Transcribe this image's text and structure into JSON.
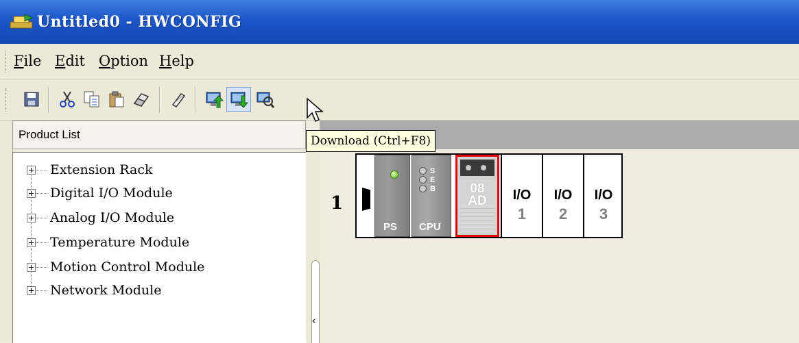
{
  "window": {
    "title": "Untitled0 - HWCONFIG"
  },
  "menu": [
    {
      "accel": "F",
      "rest": "ile"
    },
    {
      "accel": "E",
      "rest": "dit"
    },
    {
      "accel": "O",
      "rest": "ption"
    },
    {
      "accel": "H",
      "rest": "elp"
    }
  ],
  "toolbar": {
    "buttons": [
      "save-icon",
      "cut-icon",
      "copy-icon",
      "paste-icon",
      "eraser-icon",
      "rename-icon",
      "upload-icon",
      "download-icon",
      "scan-icon"
    ],
    "tooltip": "Download (Ctrl+F8)"
  },
  "left_panel": {
    "header": "Product List",
    "items": [
      "Extension Rack",
      "Digital I/O Module",
      "Analog I/O Module",
      "Temperature Module",
      "Motion Control Module",
      "Network Module"
    ]
  },
  "rack": {
    "number": "1",
    "ps_label": "PS",
    "cpu_label": "CPU",
    "cpu_leds": [
      "S",
      "E",
      "B"
    ],
    "ad_line1": "08",
    "ad_line2": "AD",
    "io_slots": [
      {
        "a": "I/O",
        "b": "1"
      },
      {
        "a": "I/O",
        "b": "2"
      },
      {
        "a": "I/O",
        "b": "3"
      }
    ]
  }
}
